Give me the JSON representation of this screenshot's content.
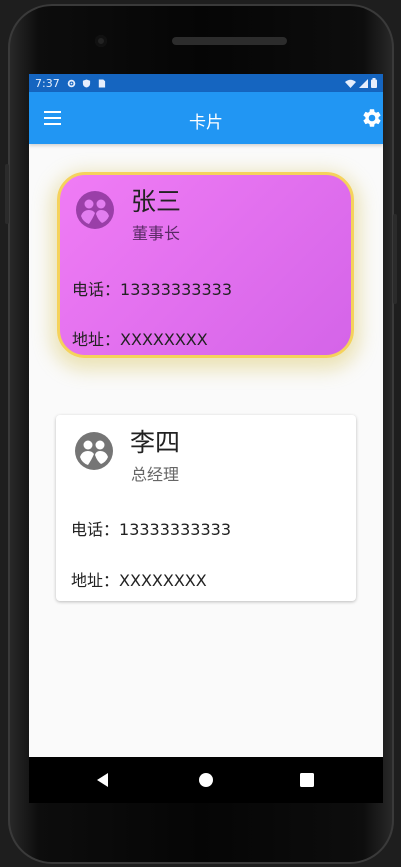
{
  "status_bar": {
    "time": "7:37",
    "icons": [
      "gear-icon",
      "shield-icon",
      "sim-icon"
    ],
    "right_icons": [
      "wifi-icon",
      "signal-icon",
      "battery-icon"
    ]
  },
  "app_bar": {
    "title": "卡片",
    "menu_icon": "menu-icon",
    "settings_icon": "gear-icon",
    "color": "#2196f3"
  },
  "cards": [
    {
      "name": "张三",
      "role": "董事长",
      "phone_label": "电话：",
      "phone": "13333333333",
      "address_label": "地址：",
      "address": "XXXXXXXX",
      "avatar_icon": "group-avatar-icon",
      "style": "gradient-rounded",
      "colors": {
        "gradient_start": "#f07cf5",
        "gradient_end": "#d464e8",
        "border": "#f5d25c"
      }
    },
    {
      "name": "李四",
      "role": "总经理",
      "phone_label": "电话：",
      "phone": "13333333333",
      "address_label": "地址：",
      "address": "XXXXXXXX",
      "avatar_icon": "group-avatar-icon",
      "style": "plain",
      "colors": {
        "background": "#ffffff"
      }
    }
  ],
  "nav_bar": {
    "buttons": [
      "back-icon",
      "home-icon",
      "recents-icon"
    ]
  }
}
